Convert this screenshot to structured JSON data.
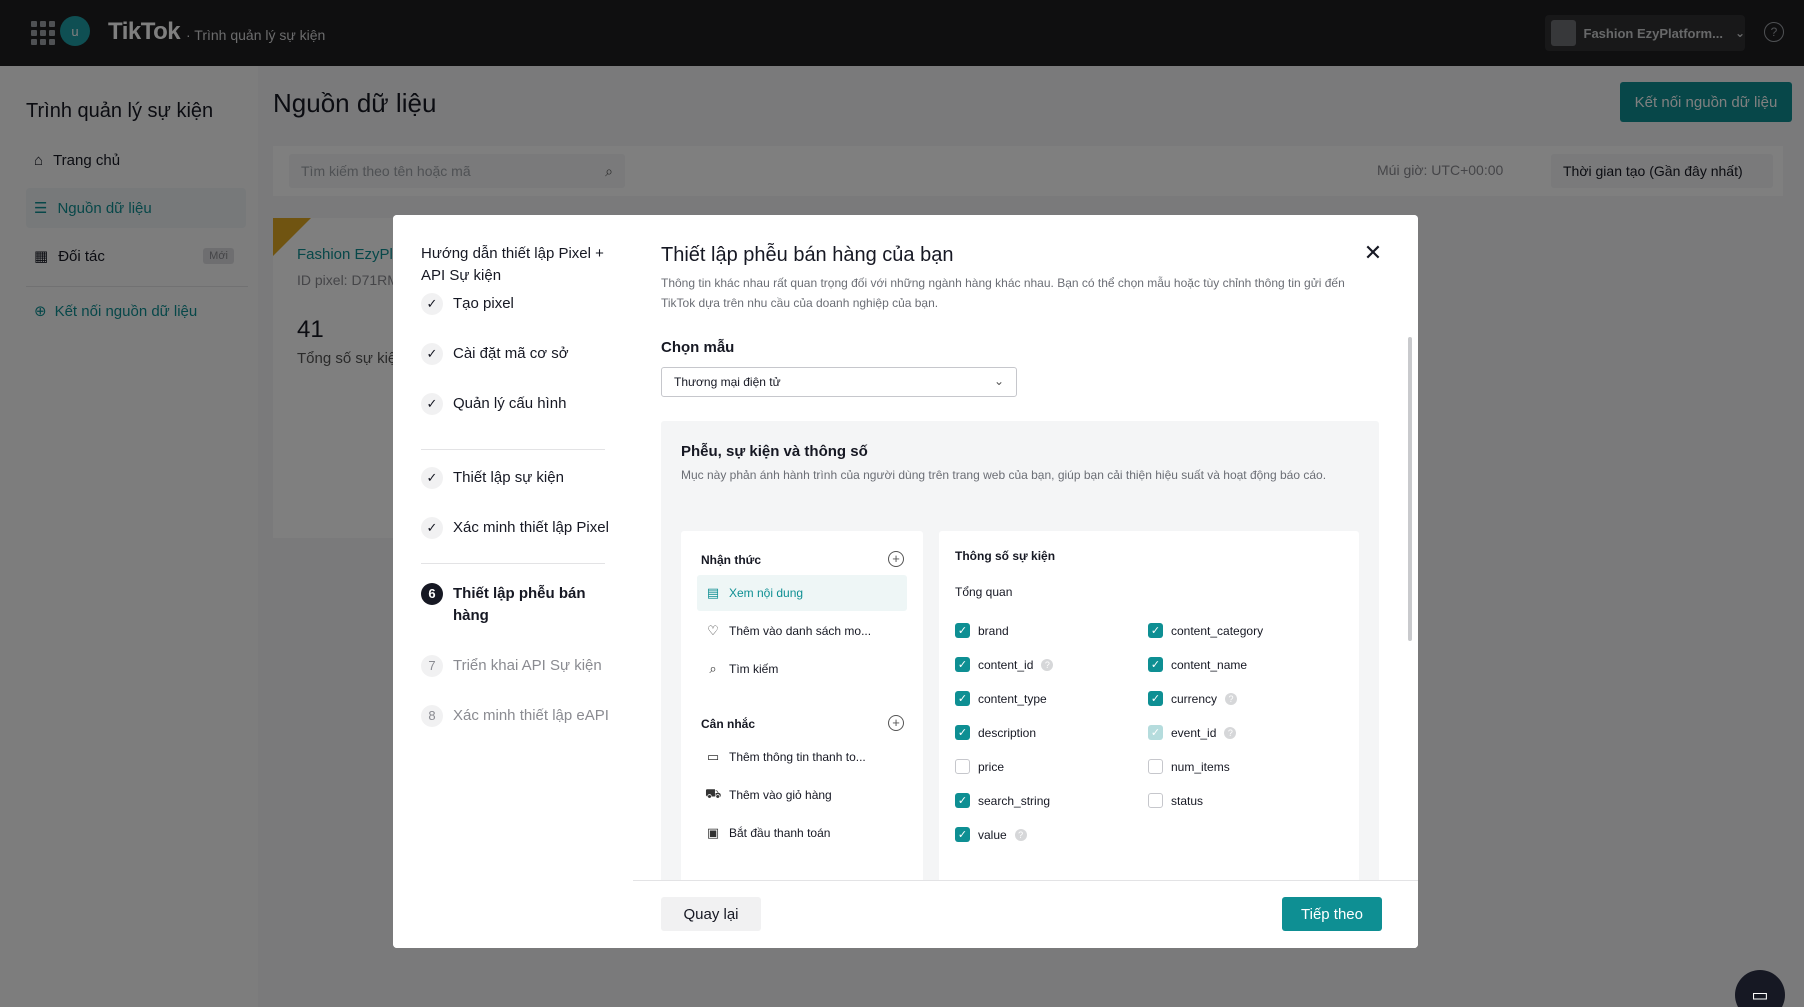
{
  "topbar": {
    "avatar_initial": "u",
    "brand": "TikTok",
    "subtitle": "· Trình quản lý sự kiện",
    "account_name": "Fashion EzyPlatform...",
    "help": "?"
  },
  "sidebar": {
    "title": "Trình quản lý sự kiện",
    "items": [
      {
        "label": "Trang chủ",
        "icon": "home-icon"
      },
      {
        "label": "Nguồn dữ liệu",
        "icon": "list-icon"
      },
      {
        "label": "Đối tác",
        "icon": "store-icon",
        "badge": "Mới"
      }
    ],
    "connect_link": "Kết nối nguồn dữ liệu"
  },
  "main": {
    "title": "Nguồn dữ liệu",
    "connect_button": "Kết nối nguồn dữ liệu",
    "search_placeholder": "Tìm kiếm theo tên hoặc mã",
    "timezone": "Múi giờ: UTC+00:00",
    "sort": "Thời gian tạo (Gần đây nhất)",
    "pixel_card": {
      "name": "Fashion EzyPla",
      "id": "ID pixel: D71RM",
      "count": "41",
      "count_label": "Tổng số sự kiện"
    }
  },
  "modal": {
    "steps_title": "Hướng dẫn thiết lập Pixel + API Sự kiện",
    "steps": [
      {
        "label": "Tạo pixel",
        "state": "done",
        "mark": "✓"
      },
      {
        "label": "Cài đặt mã cơ sở",
        "state": "done",
        "mark": "✓"
      },
      {
        "label": "Quản lý cấu hình",
        "state": "done",
        "mark": "✓"
      },
      {
        "label": "Thiết lập sự kiện",
        "state": "done",
        "mark": "✓"
      },
      {
        "label": "Xác minh thiết lập Pixel",
        "state": "done",
        "mark": "✓"
      },
      {
        "label": "Thiết lập phễu bán hàng",
        "state": "current",
        "mark": "6"
      },
      {
        "label": "Triển khai API Sự kiện",
        "state": "todo",
        "mark": "7"
      },
      {
        "label": "Xác minh thiết lập eAPI",
        "state": "todo",
        "mark": "8"
      }
    ],
    "title": "Thiết lập phễu bán hàng của bạn",
    "description": "Thông tin khác nhau rất quan trọng đối với những ngành hàng khác nhau. Bạn có thể chọn mẫu hoặc tùy chỉnh thông tin gửi đến TikTok dựa trên nhu cầu của doanh nghiệp của bạn.",
    "template_label": "Chọn mẫu",
    "template_value": "Thương mại điện tử",
    "funnel_title": "Phễu, sự kiện và thông số",
    "funnel_desc": "Mục này phản ánh hành trình của người dùng trên trang web của bạn, giúp bạn cải thiện hiệu suất và hoạt động báo cáo.",
    "groups": [
      {
        "title": "Nhận thức",
        "events": [
          {
            "label": "Xem nội dung",
            "icon": "content-view-icon",
            "selected": true
          },
          {
            "label": "Thêm vào danh sách mo...",
            "icon": "heart-icon",
            "selected": false
          },
          {
            "label": "Tìm kiếm",
            "icon": "search-icon",
            "selected": false
          }
        ]
      },
      {
        "title": "Cân nhắc",
        "events": [
          {
            "label": "Thêm thông tin thanh to...",
            "icon": "clipboard-icon",
            "selected": false
          },
          {
            "label": "Thêm vào giỏ hàng",
            "icon": "cart-icon",
            "selected": false
          },
          {
            "label": "Bắt đầu thanh toán",
            "icon": "payment-icon",
            "selected": false
          }
        ]
      }
    ],
    "params_title": "Thông số sự kiện",
    "params_sub": "Tổng quan",
    "params": [
      {
        "name": "brand",
        "state": "on",
        "help": false
      },
      {
        "name": "content_category",
        "state": "on",
        "help": false
      },
      {
        "name": "content_id",
        "state": "on",
        "help": true
      },
      {
        "name": "content_name",
        "state": "on",
        "help": false
      },
      {
        "name": "content_type",
        "state": "on",
        "help": false
      },
      {
        "name": "currency",
        "state": "on",
        "help": true
      },
      {
        "name": "description",
        "state": "on",
        "help": false
      },
      {
        "name": "event_id",
        "state": "dis",
        "help": true
      },
      {
        "name": "price",
        "state": "off",
        "help": false
      },
      {
        "name": "num_items",
        "state": "off",
        "help": false
      },
      {
        "name": "search_string",
        "state": "on",
        "help": false
      },
      {
        "name": "status",
        "state": "off",
        "help": false
      },
      {
        "name": "value",
        "state": "on",
        "help": true
      }
    ],
    "back_button": "Quay lại",
    "next_button": "Tiếp theo"
  },
  "colors": {
    "accent": "#0e8f93",
    "topbar": "#1f1f21"
  }
}
